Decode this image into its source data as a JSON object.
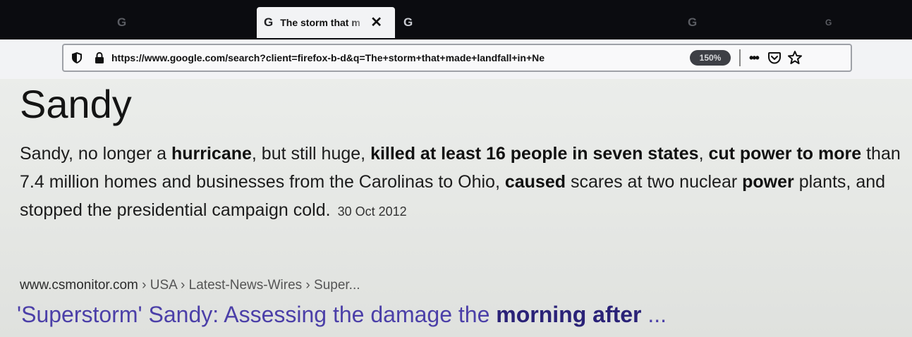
{
  "browser": {
    "tabs": [
      {
        "favicon": "G",
        "title": ""
      },
      {
        "favicon": "G",
        "title": "The storm that m",
        "active": true,
        "close": "✕"
      },
      {
        "favicon": "G",
        "title": ""
      },
      {
        "favicon": "G",
        "title": ""
      },
      {
        "favicon": "G",
        "title": ""
      }
    ],
    "url": "https://www.google.com/search?client=firefox-b-d&q=The+storm+that+made+landfall+in+Ne",
    "zoom": "150%",
    "page_actions": "•••",
    "icons": [
      "tracking-shield-icon",
      "lock-icon",
      "page-actions-icon",
      "pocket-icon",
      "bookmark-star-icon"
    ]
  },
  "answer": {
    "title": "Sandy",
    "snippet": {
      "s1": "Sandy, no longer a ",
      "b1": "hurricane",
      "s2": ", but still huge, ",
      "b2": "killed at least 16 people in seven states",
      "s3": ", ",
      "b3": "cut power to more",
      "s4": " than 7.4 million homes and businesses from the Carolinas to Ohio, ",
      "b4": "caused",
      "s5": " scares at two nuclear ",
      "b5": "power",
      "s6": " plants, and stopped the presidential campaign cold.",
      "date": "30 Oct 2012"
    },
    "source": {
      "domain": "www.csmonitor.com",
      "path": " › USA › Latest-News-Wires › Super..."
    },
    "result_link": {
      "part1": "'Superstorm' Sandy: Assessing the damage the ",
      "bold": "morning after",
      "part2": " ..."
    }
  },
  "colors": {
    "tab_strip": "#0b0c10",
    "toolbar": "#f2f3f5",
    "link": "#4b3fa8",
    "text": "#1c1c1c"
  }
}
